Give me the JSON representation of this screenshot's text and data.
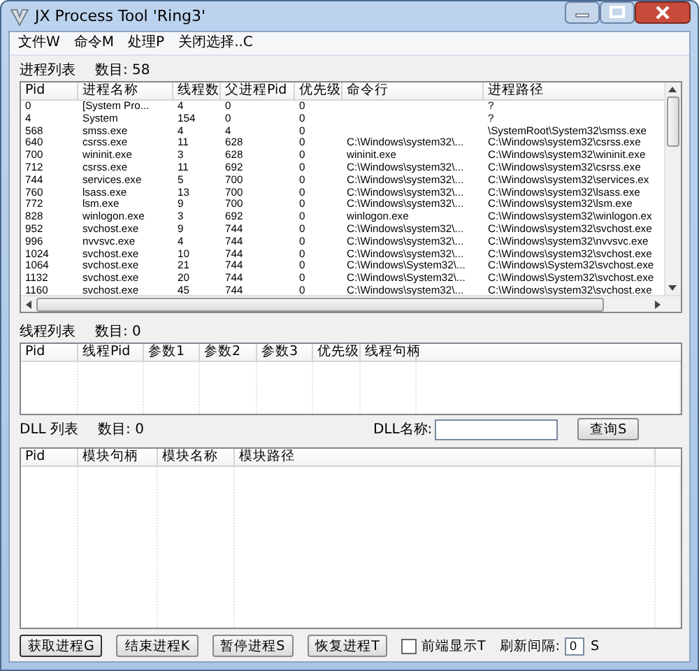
{
  "window": {
    "title": "JX Process Tool 'Ring3'"
  },
  "menu": [
    "文件W",
    "命令M",
    "处理P",
    "关闭选择..C"
  ],
  "process_list": {
    "label": "进程列表",
    "count": "数目: 58",
    "columns": [
      "Pid",
      "进程名称",
      "线程数",
      "父进程Pid",
      "优先级",
      "命令行",
      "进程路径"
    ],
    "rows": [
      [
        "0",
        "[System Pro...",
        "4",
        "0",
        "0",
        "",
        "?"
      ],
      [
        "4",
        "System",
        "154",
        "0",
        "0",
        "",
        "?"
      ],
      [
        "568",
        "smss.exe",
        "4",
        "4",
        "0",
        "",
        "\\SystemRoot\\System32\\smss.exe"
      ],
      [
        "640",
        "csrss.exe",
        "11",
        "628",
        "0",
        "C:\\Windows\\system32\\...",
        "C:\\Windows\\system32\\csrss.exe"
      ],
      [
        "700",
        "wininit.exe",
        "3",
        "628",
        "0",
        "wininit.exe",
        "C:\\Windows\\system32\\wininit.exe"
      ],
      [
        "712",
        "csrss.exe",
        "11",
        "692",
        "0",
        "C:\\Windows\\system32\\...",
        "C:\\Windows\\system32\\csrss.exe"
      ],
      [
        "744",
        "services.exe",
        "5",
        "700",
        "0",
        "C:\\Windows\\system32\\...",
        "C:\\Windows\\system32\\services.ex"
      ],
      [
        "760",
        "lsass.exe",
        "13",
        "700",
        "0",
        "C:\\Windows\\system32\\...",
        "C:\\Windows\\system32\\lsass.exe"
      ],
      [
        "772",
        "lsm.exe",
        "9",
        "700",
        "0",
        "C:\\Windows\\system32\\...",
        "C:\\Windows\\system32\\lsm.exe"
      ],
      [
        "828",
        "winlogon.exe",
        "3",
        "692",
        "0",
        "winlogon.exe",
        "C:\\Windows\\system32\\winlogon.ex"
      ],
      [
        "952",
        "svchost.exe",
        "9",
        "744",
        "0",
        "C:\\Windows\\system32\\...",
        "C:\\Windows\\system32\\svchost.exe"
      ],
      [
        "996",
        "nvvsvc.exe",
        "4",
        "744",
        "0",
        "C:\\Windows\\system32\\...",
        "C:\\Windows\\system32\\nvvsvc.exe"
      ],
      [
        "1024",
        "svchost.exe",
        "10",
        "744",
        "0",
        "C:\\Windows\\system32\\...",
        "C:\\Windows\\system32\\svchost.exe"
      ],
      [
        "1064",
        "svchost.exe",
        "21",
        "744",
        "0",
        "C:\\Windows\\System32\\...",
        "C:\\Windows\\System32\\svchost.exe"
      ],
      [
        "1132",
        "svchost.exe",
        "20",
        "744",
        "0",
        "C:\\Windows\\System32\\...",
        "C:\\Windows\\System32\\svchost.exe"
      ],
      [
        "1160",
        "svchost.exe",
        "45",
        "744",
        "0",
        "C:\\Windows\\system32\\...",
        "C:\\Windows\\system32\\svchost.exe"
      ]
    ]
  },
  "thread_list": {
    "label": "线程列表",
    "count": "数目: 0",
    "columns": [
      "Pid",
      "线程Pid",
      "参数1",
      "参数2",
      "参数3",
      "优先级",
      "线程句柄"
    ]
  },
  "dll_list": {
    "label": "DLL 列表",
    "count": "数目: 0",
    "name_label": "DLL名称:",
    "query_button": "查询S",
    "columns": [
      "Pid",
      "模块句柄",
      "模块名称",
      "模块路径"
    ]
  },
  "buttons": [
    "获取进程G",
    "结束进程K",
    "暂停进程S",
    "恢复进程T"
  ],
  "topmost": {
    "label": "前端显示T",
    "checked": false
  },
  "interval": {
    "label": "刷新间隔:",
    "value": "0",
    "unit": "S"
  }
}
